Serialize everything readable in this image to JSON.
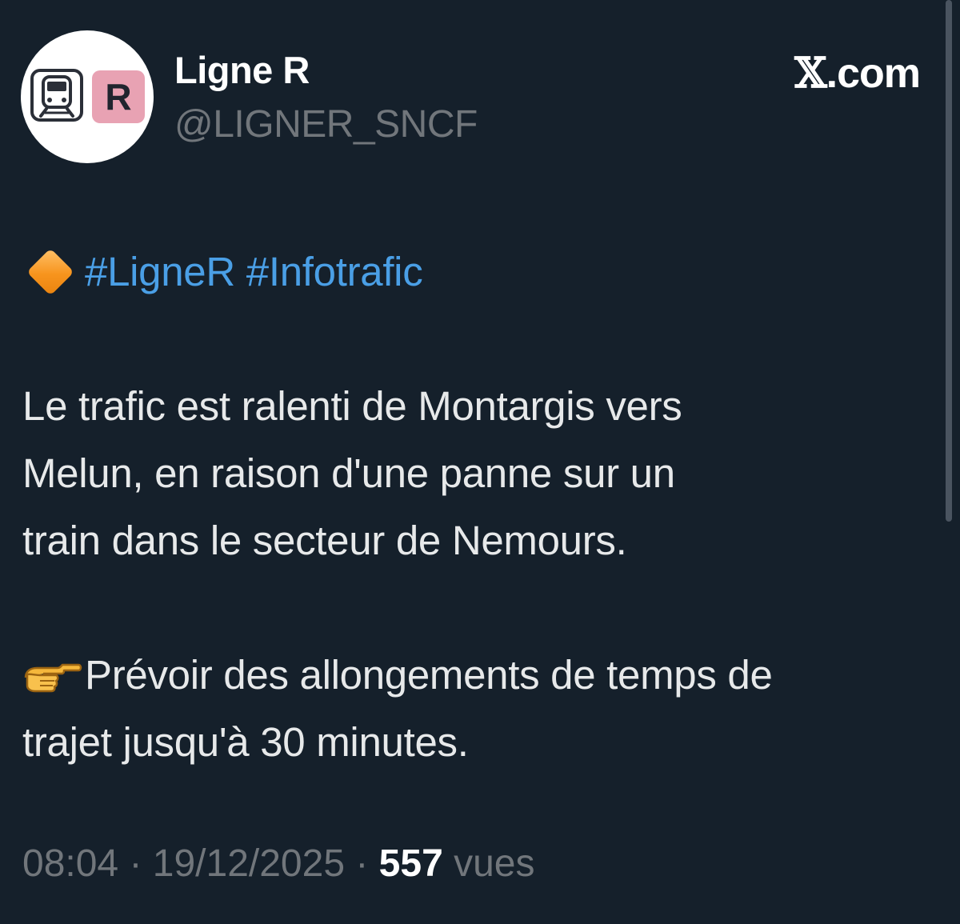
{
  "author": {
    "display_name": "Ligne R",
    "handle": "@LIGNER_SNCF",
    "avatar_badge": "R"
  },
  "site": {
    "x_glyph": "𝕏",
    "suffix": ".com"
  },
  "tweet": {
    "hashtag_1": "#LigneR",
    "hashtag_2": "#Infotrafic",
    "paragraph_1": [
      "Le trafic est ralenti de Montargis vers",
      "Melun, en raison d'une panne sur un",
      "train dans le secteur de Nemours."
    ],
    "paragraph_2": [
      "Prévoir des allongements de temps de",
      "trajet jusqu'à 30 minutes."
    ]
  },
  "meta": {
    "time": "08:04",
    "separator": " · ",
    "date": "19/12/2025",
    "views_count": "557",
    "views_label": "vues"
  },
  "icons": {
    "bullet": "orange-diamond-icon",
    "pointer": "pointing-hand-icon",
    "avatar": "train-icon"
  },
  "colors": {
    "background": "#15202b",
    "hashtag": "#4a9fe6",
    "muted": "#71767b",
    "badge": "#e8a2b3"
  }
}
